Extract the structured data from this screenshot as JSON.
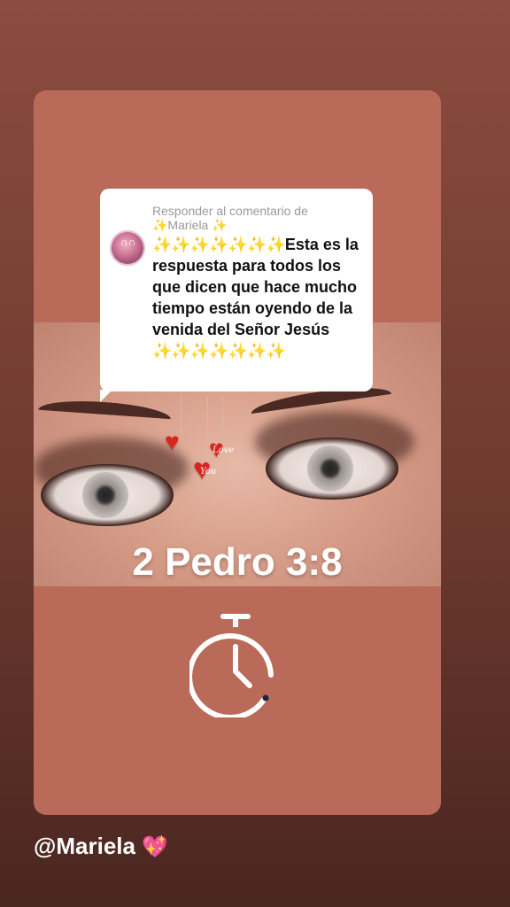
{
  "reply": {
    "header": "Responder al comentario de ✨Mariela ✨",
    "sparkles_lead": "✨✨✨✨✨✨✨",
    "body": "Esta es la respuesta para todos los que dicen que hace mucho tiempo están oyendo de la venida del Señor Jesús",
    "sparkles_tail": "✨✨✨✨✨✨✨"
  },
  "sticker": {
    "love_text": "Love",
    "you_text": "You"
  },
  "verse": "2 Pedro 3:8",
  "footer": {
    "username": "@Mariela",
    "emoji": "💖"
  },
  "icons": [
    "stopwatch-icon",
    "heart-icon",
    "avatar"
  ],
  "colors": {
    "card_background": "#b96a58",
    "sparkle": "#f3c623",
    "heart": "#d8261e"
  }
}
